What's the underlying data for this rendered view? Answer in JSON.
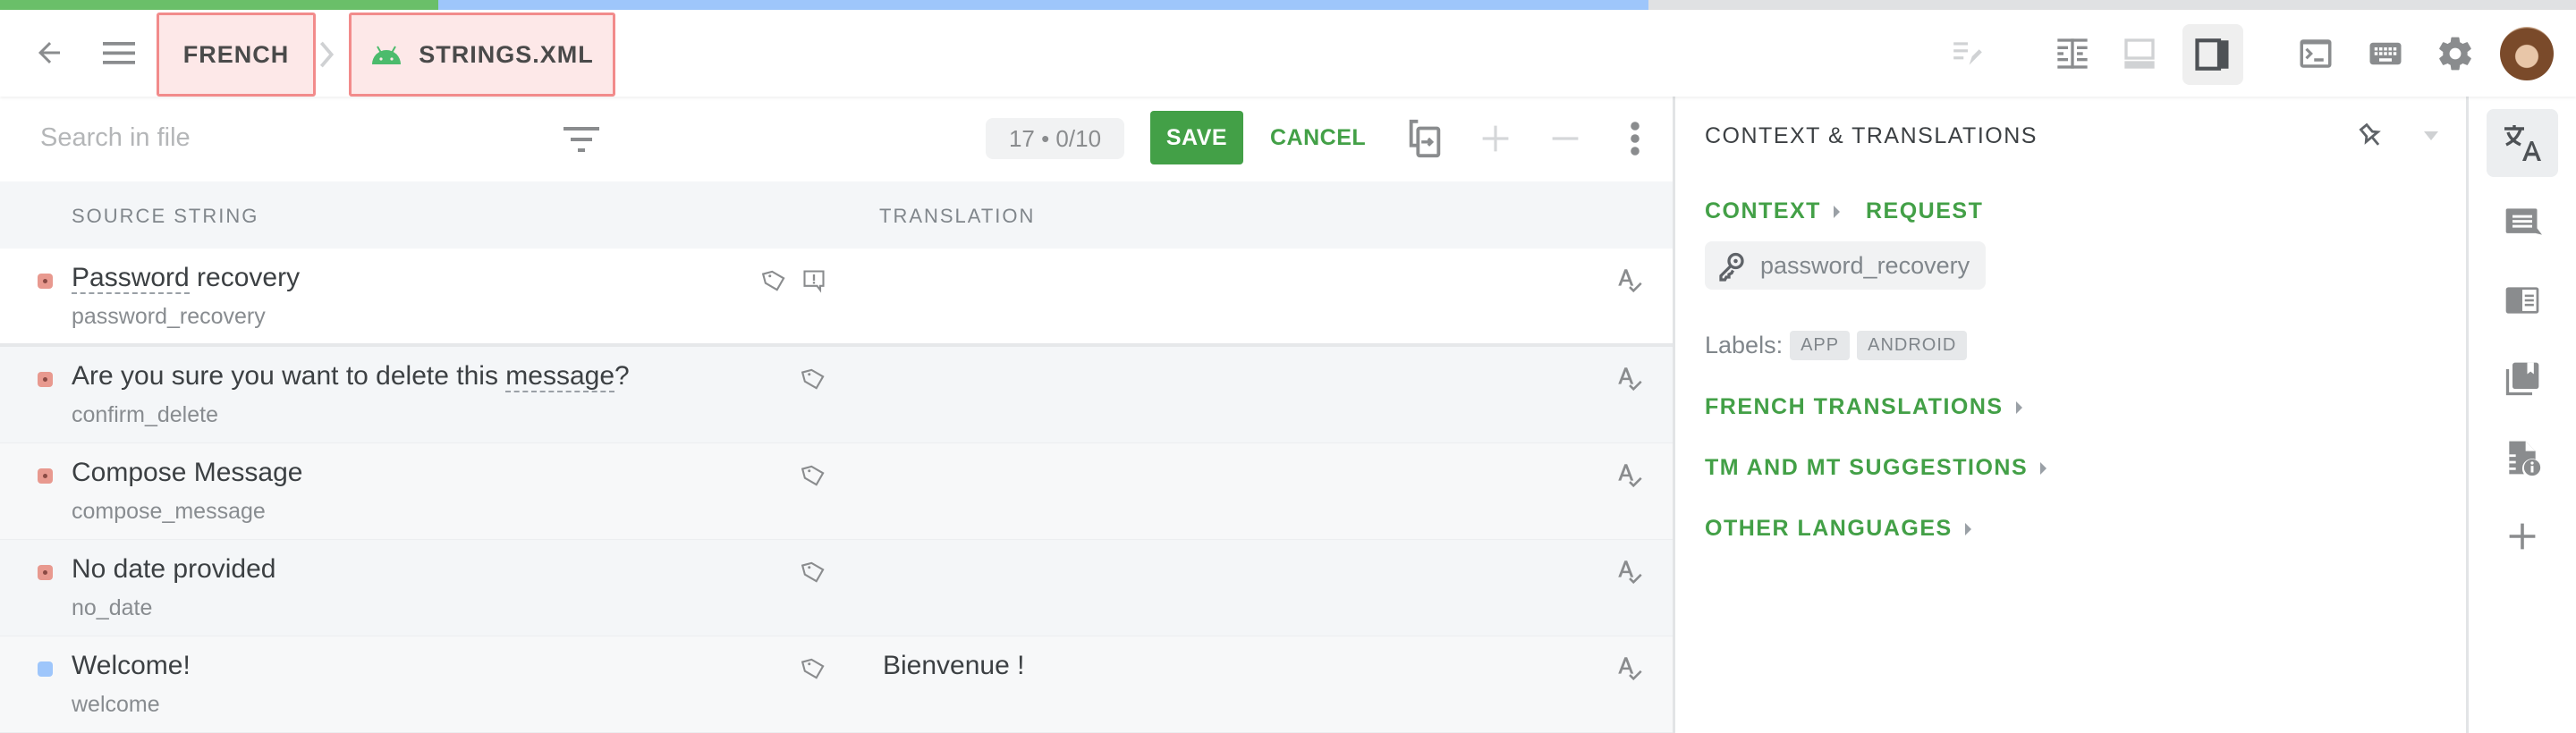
{
  "progress": {
    "translated_pct": 17,
    "in_progress_pct": 47,
    "colors": {
      "translated": "#6abf69",
      "in_progress": "#9ec6fb",
      "remaining": "#e0e1e3"
    }
  },
  "header": {
    "back_icon": "arrow-left-icon",
    "menu_icon": "hamburger-menu-icon",
    "breadcrumb": [
      {
        "label": "FRENCH"
      },
      {
        "label": "STRINGS.XML",
        "icon": "android-icon"
      }
    ],
    "right_icons": [
      "edit-lines-icon",
      "side-by-side-layout-icon",
      "bottom-panel-layout-icon",
      "right-panel-layout-icon",
      "terminal-icon",
      "keyboard-icon",
      "settings-gear-icon",
      "user-avatar"
    ]
  },
  "toolbar": {
    "search_placeholder": "Search in file",
    "counter": "17 • 0/10",
    "save_label": "SAVE",
    "cancel_label": "CANCEL"
  },
  "table": {
    "columns": {
      "source": "SOURCE STRING",
      "translation": "TRANSLATION"
    },
    "rows": [
      {
        "source": "Password recovery",
        "source_pre": "",
        "source_dash": "Password",
        "source_post": " recovery",
        "key": "password_recovery",
        "translation": "",
        "status": "untranslated",
        "has_issue": true
      },
      {
        "source": "Are you sure you want to delete this message?",
        "source_pre": "Are you sure you want to delete this ",
        "source_dash": "message",
        "source_post": "?",
        "key": "confirm_delete",
        "translation": "",
        "status": "untranslated",
        "has_issue": false
      },
      {
        "source": "Compose Message",
        "key": "compose_message",
        "translation": "",
        "status": "untranslated",
        "has_issue": false
      },
      {
        "source": "No date provided",
        "key": "no_date",
        "translation": "",
        "status": "untranslated",
        "has_issue": false
      },
      {
        "source": "Welcome!",
        "key": "welcome",
        "translation": "Bienvenue !",
        "status": "translated",
        "has_issue": false
      }
    ],
    "status_colors": {
      "untranslated": "#e8998f",
      "translated": "#9ec6fb"
    }
  },
  "panel": {
    "title": "CONTEXT & TRANSLATIONS",
    "context_label": "CONTEXT",
    "request_label": "REQUEST",
    "key": "password_recovery",
    "labels_caption": "Labels:",
    "labels": [
      "APP",
      "ANDROID"
    ],
    "sections": [
      "FRENCH TRANSLATIONS",
      "TM AND MT SUGGESTIONS",
      "OTHER LANGUAGES"
    ]
  },
  "rail": {
    "items": [
      "translate-icon",
      "comments-icon",
      "glossary-icon",
      "bookmarks-icon",
      "file-info-icon",
      "add-icon"
    ],
    "active": 0
  },
  "accent": "#43a047"
}
